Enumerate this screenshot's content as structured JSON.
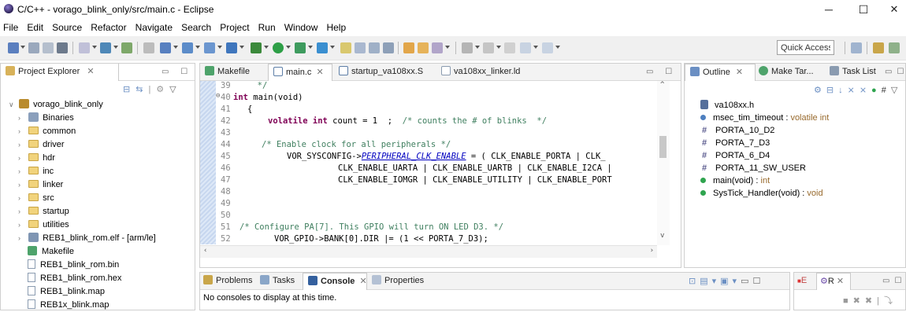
{
  "window": {
    "title": "C/C++ - vorago_blink_only/src/main.c - Eclipse",
    "controls": {
      "minimize": "─",
      "maximize": "☐",
      "close": "✕"
    }
  },
  "menu": [
    "File",
    "Edit",
    "Source",
    "Refactor",
    "Navigate",
    "Search",
    "Project",
    "Run",
    "Window",
    "Help"
  ],
  "toolbar": {
    "quick_access": "Quick Access"
  },
  "project_explorer": {
    "tab_label": "Project Explorer",
    "close": "✕",
    "items": [
      {
        "label": "vorago_blink_only",
        "kind": "project",
        "expanded": true
      },
      {
        "label": "Binaries",
        "kind": "binaries"
      },
      {
        "label": "common",
        "kind": "folder"
      },
      {
        "label": "driver",
        "kind": "folder"
      },
      {
        "label": "hdr",
        "kind": "folder"
      },
      {
        "label": "inc",
        "kind": "folder"
      },
      {
        "label": "linker",
        "kind": "folder"
      },
      {
        "label": "src",
        "kind": "folder"
      },
      {
        "label": "startup",
        "kind": "folder"
      },
      {
        "label": "utilities",
        "kind": "folder"
      },
      {
        "label": "REB1_blink_rom.elf - [arm/le]",
        "kind": "elf"
      },
      {
        "label": "Makefile",
        "kind": "makefile"
      },
      {
        "label": "REB1_blink_rom.bin",
        "kind": "file"
      },
      {
        "label": "REB1_blink_rom.hex",
        "kind": "file"
      },
      {
        "label": "REB1_blink.map",
        "kind": "file"
      },
      {
        "label": "REB1x_blink.map",
        "kind": "file"
      }
    ]
  },
  "editor": {
    "tabs": [
      {
        "label": "Makefile",
        "active": false
      },
      {
        "label": "main.c",
        "active": true
      },
      {
        "label": "startup_va108xx.S",
        "active": false
      },
      {
        "label": "va108xx_linker.ld",
        "active": false
      }
    ],
    "close": "✕",
    "lines": [
      {
        "num": "39",
        "text": "  */"
      },
      {
        "num": "40",
        "fold": "⊖",
        "kw": "int",
        "text": " main(void)"
      },
      {
        "num": "41",
        "text": "{"
      },
      {
        "num": "42",
        "kw": "volatile int",
        "text": " count = 1  ;",
        "comment": "/* counts the # of blinks  */"
      },
      {
        "num": "43",
        "text": ""
      },
      {
        "num": "44",
        "comment": "/* Enable clock for all peripherals */"
      },
      {
        "num": "45",
        "pre": "VOR_SYSCONFIG->",
        "macro": "PERIPHERAL_CLK_ENABLE",
        "text": " = ( CLK_ENABLE_PORTA | CLK_"
      },
      {
        "num": "46",
        "text": "CLK_ENABLE_UARTA | CLK_ENABLE_UARTB | CLK_ENABLE_I2CA |"
      },
      {
        "num": "47",
        "text": "CLK_ENABLE_IOMGR | CLK_ENABLE_UTILITY | CLK_ENABLE_PORT"
      },
      {
        "num": "48",
        "text": ""
      },
      {
        "num": "49",
        "text": ""
      },
      {
        "num": "50",
        "text": ""
      },
      {
        "num": "51",
        "comment": "/* Configure PA[7]. This GPIO will turn ON LED D3. */"
      },
      {
        "num": "52",
        "text": "VOR_GPIO->BANK[0].DIR |= (1 << PORTA_7_D3);"
      }
    ]
  },
  "outline": {
    "tabs": [
      {
        "label": "Outline",
        "active": true
      },
      {
        "label": "Make Tar...",
        "active": false
      },
      {
        "label": "Task List",
        "active": false
      }
    ],
    "close": "✕",
    "items": [
      {
        "kind": "include",
        "name": "va108xx.h"
      },
      {
        "kind": "var",
        "name": "msec_tim_timeout",
        "type": "volatile int"
      },
      {
        "kind": "macro",
        "name": "PORTA_10_D2"
      },
      {
        "kind": "macro",
        "name": "PORTA_7_D3"
      },
      {
        "kind": "macro",
        "name": "PORTA_6_D4"
      },
      {
        "kind": "macro",
        "name": "PORTA_11_SW_USER"
      },
      {
        "kind": "func",
        "name": "main(void)",
        "type": "int"
      },
      {
        "kind": "func",
        "name": "SysTick_Handler(void)",
        "type": "void"
      }
    ]
  },
  "bottom": {
    "tabs": [
      {
        "label": "Problems",
        "active": false
      },
      {
        "label": "Tasks",
        "active": false
      },
      {
        "label": "Console",
        "active": true
      },
      {
        "label": "Properties",
        "active": false
      }
    ],
    "close": "✕",
    "message": "No consoles to display at this time."
  },
  "bottom_right": {
    "tabs": [
      {
        "label": "E",
        "active": false
      },
      {
        "label": "R",
        "active": true
      }
    ],
    "close": "✕"
  }
}
